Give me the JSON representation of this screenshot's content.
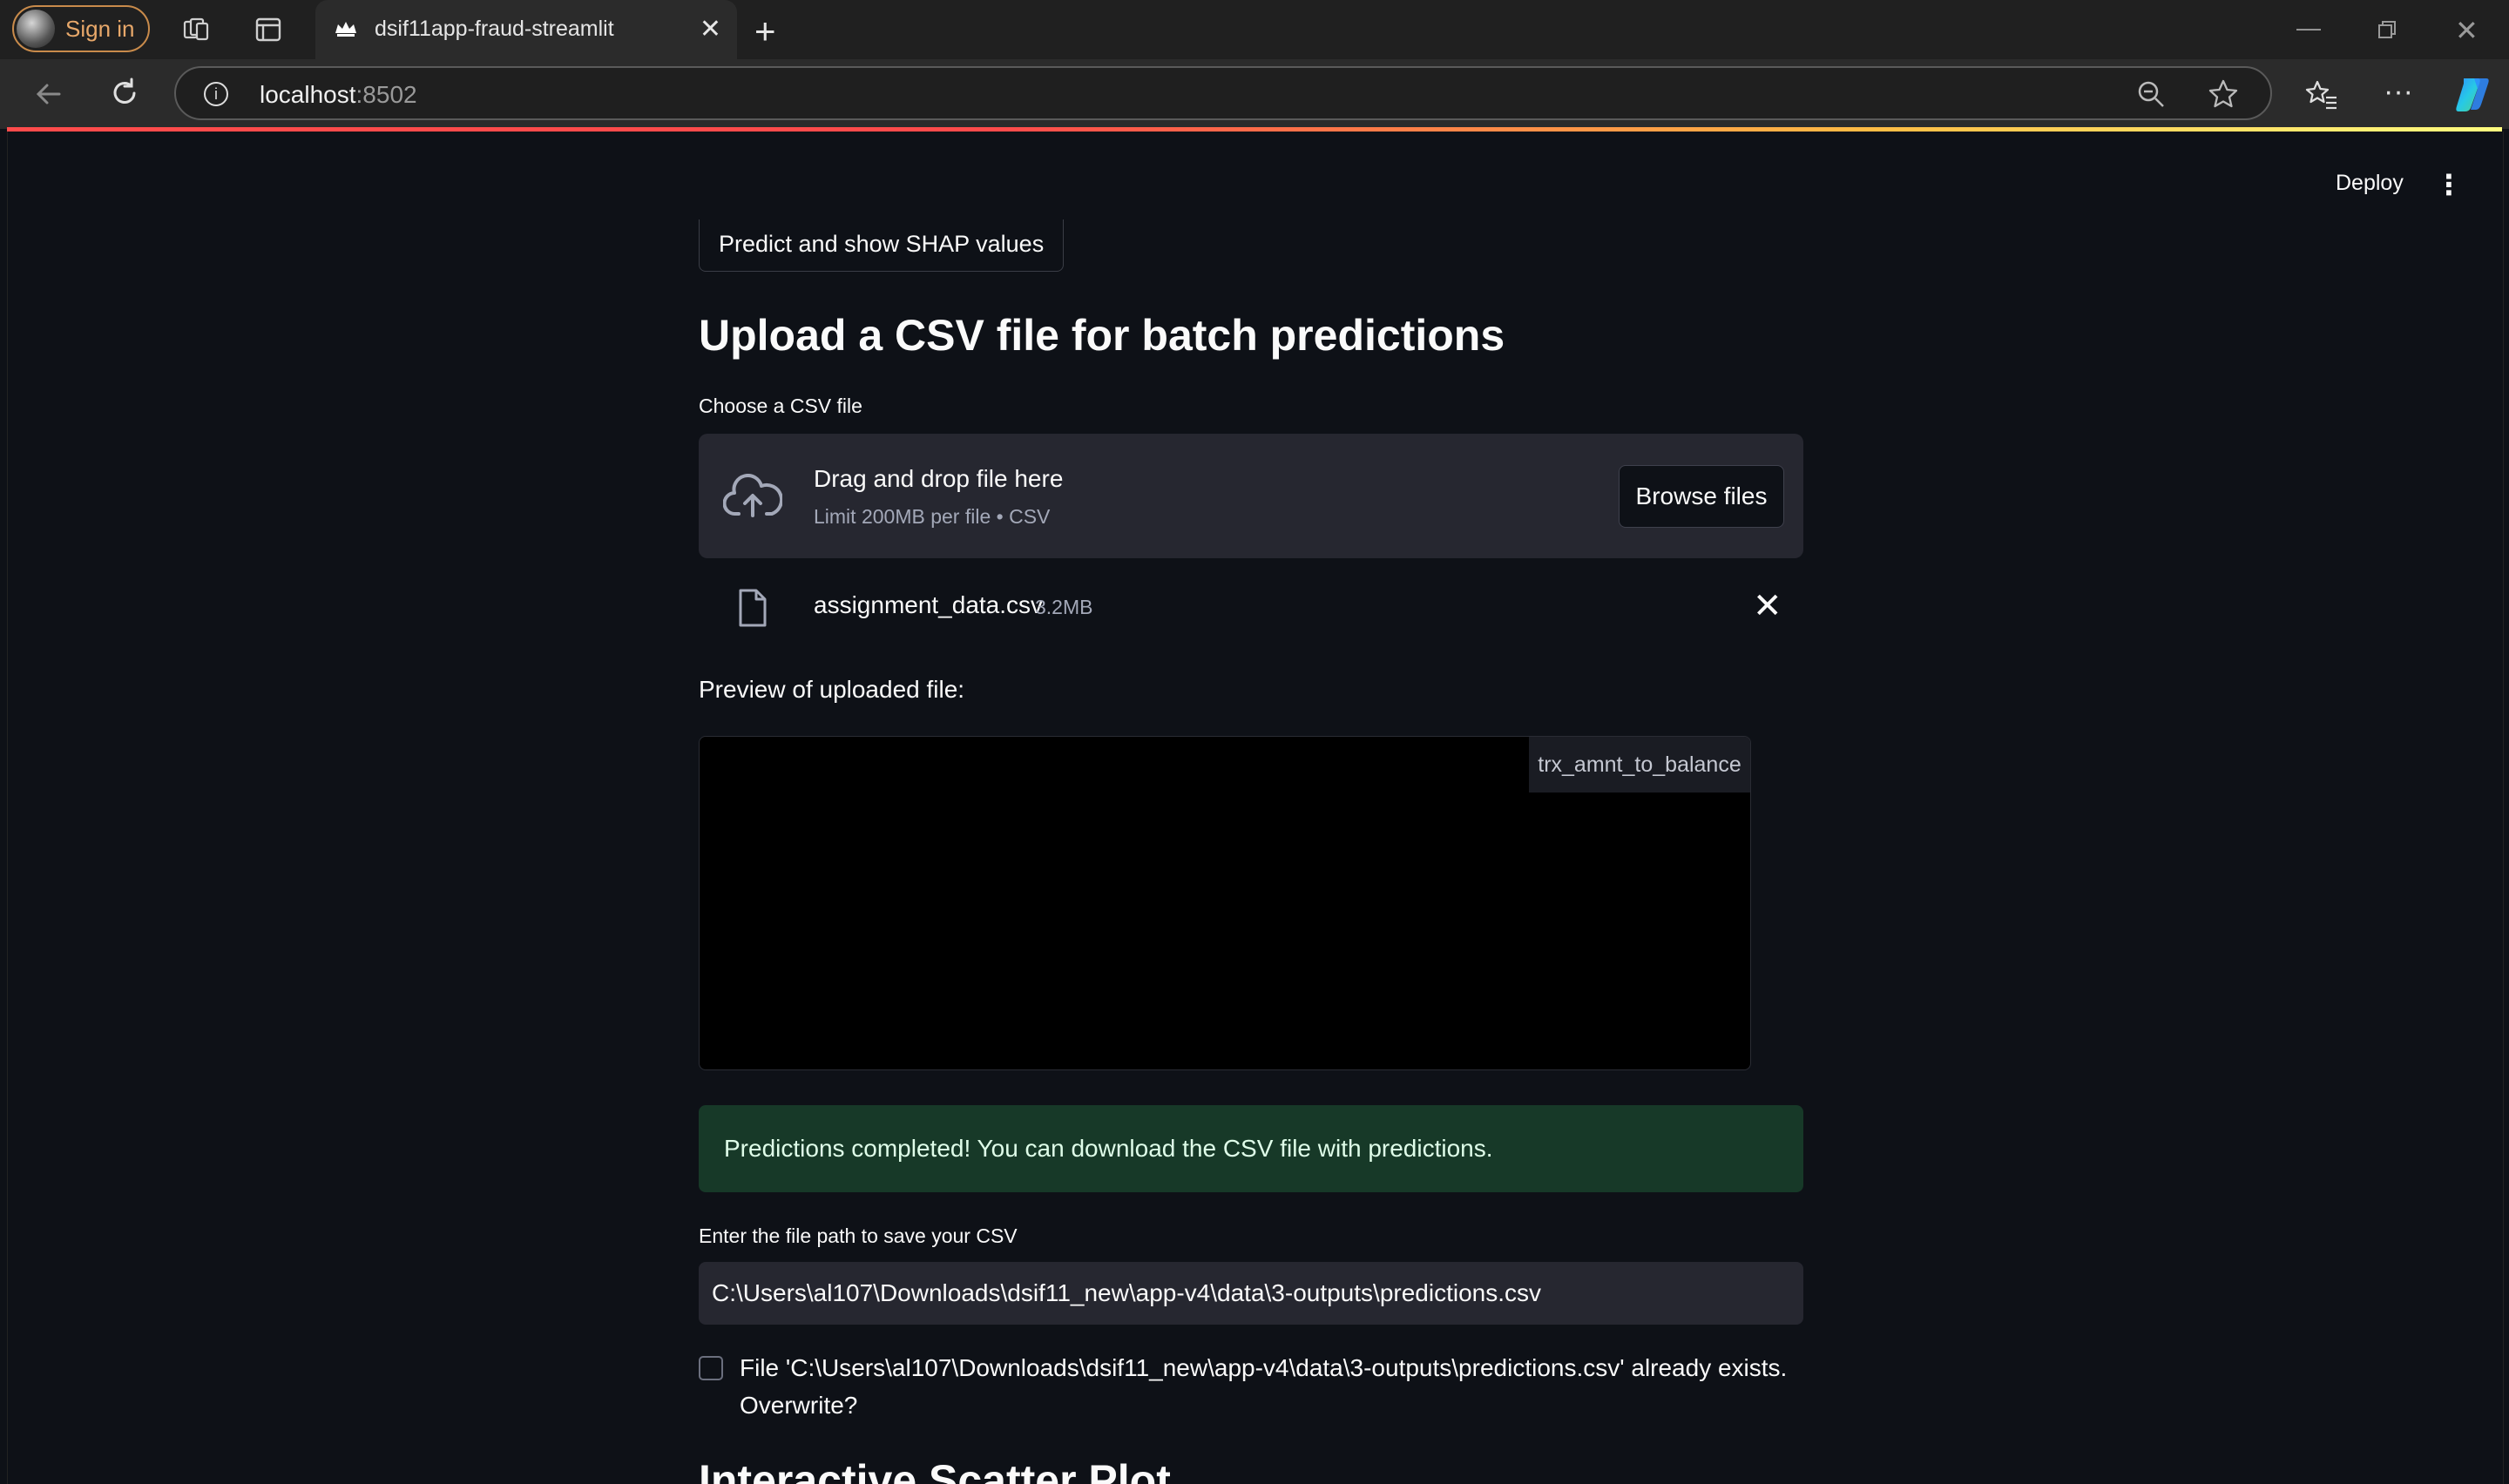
{
  "browser": {
    "signin_label": "Sign in",
    "tab_title": "dsif11app-fraud-streamlit",
    "address_host": "localhost",
    "address_port": ":8502",
    "icons": [
      "workspaces-icon",
      "tab-actions-icon",
      "back-icon",
      "refresh-icon",
      "site-info-icon",
      "zoom-icon",
      "favorite-star-icon",
      "favorites-icon",
      "more-icon",
      "copilot-icon",
      "minimize-icon",
      "restore-icon",
      "close-window-icon"
    ]
  },
  "app": {
    "header": {
      "deploy_label": "Deploy"
    },
    "shap_button_label": "Predict and show SHAP values",
    "upload_heading": "Upload a CSV file for batch predictions",
    "uploader": {
      "label": "Choose a CSV file",
      "drop_title": "Drag and drop file here",
      "drop_limit": "Limit 200MB per file • CSV",
      "browse_label": "Browse files"
    },
    "uploaded_file": {
      "name": "assignment_data.csv",
      "size": "3.2MB"
    },
    "preview_label": "Preview of uploaded file:",
    "preview_columns": [
      "trx_amnt_to_balance"
    ],
    "success_message": "Predictions completed! You can download the CSV file with predictions.",
    "save": {
      "label": "Enter the file path to save your CSV",
      "value": "C:\\Users\\al107\\Downloads\\dsif11_new\\app-v4\\data\\3-outputs\\predictions.csv",
      "overwrite_label": "File 'C:\\Users\\al107\\Downloads\\dsif11_new\\app-v4\\data\\3-outputs\\predictions.csv' already exists. Overwrite?",
      "overwrite_checked": false
    },
    "next_heading": "Interactive Scatter Plot"
  },
  "colors": {
    "background": "#0e1117",
    "widget": "#262730",
    "success_bg": "#173928",
    "accent_loading": "#ff4b4b"
  }
}
